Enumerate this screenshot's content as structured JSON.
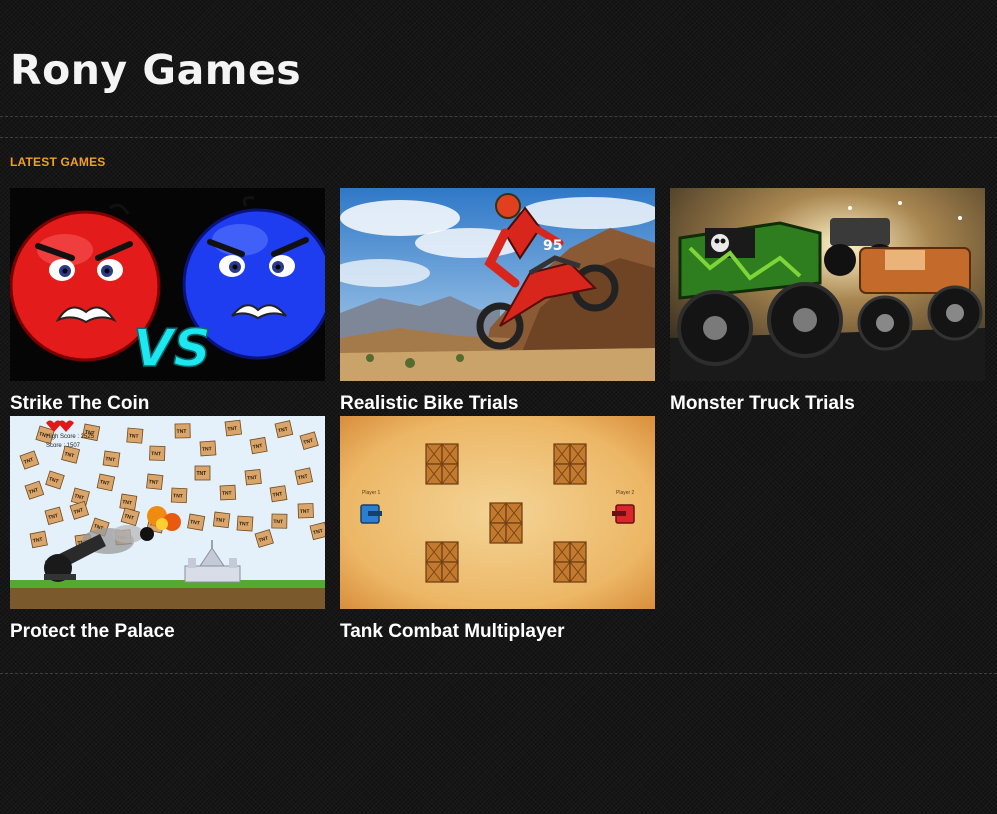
{
  "site": {
    "title": "Rony Games"
  },
  "section": {
    "heading": "LATEST GAMES"
  },
  "games": [
    {
      "title": "Strike The Coin",
      "thumb_icon": "angry-red-and-blue-faces-vs"
    },
    {
      "title": "Realistic Bike Trials",
      "thumb_icon": "motocross-rider-jump"
    },
    {
      "title": "Monster Truck Trials",
      "thumb_icon": "monster-trucks"
    },
    {
      "title": "Protect the Palace",
      "thumb_icon": "cannon-and-tnt-boxes"
    },
    {
      "title": "Tank Combat Multiplayer",
      "thumb_icon": "tanks-and-crates-arena"
    }
  ],
  "thumb_text": {
    "vs": "VS",
    "tnt": "TNT",
    "high_score": "High Score : 2525",
    "score": "Score : 1507",
    "player1": "Player 1",
    "player2": "Player 2"
  },
  "colors": {
    "background": "#161616",
    "accent": "#f0a020",
    "title_text": "#ffffff"
  }
}
